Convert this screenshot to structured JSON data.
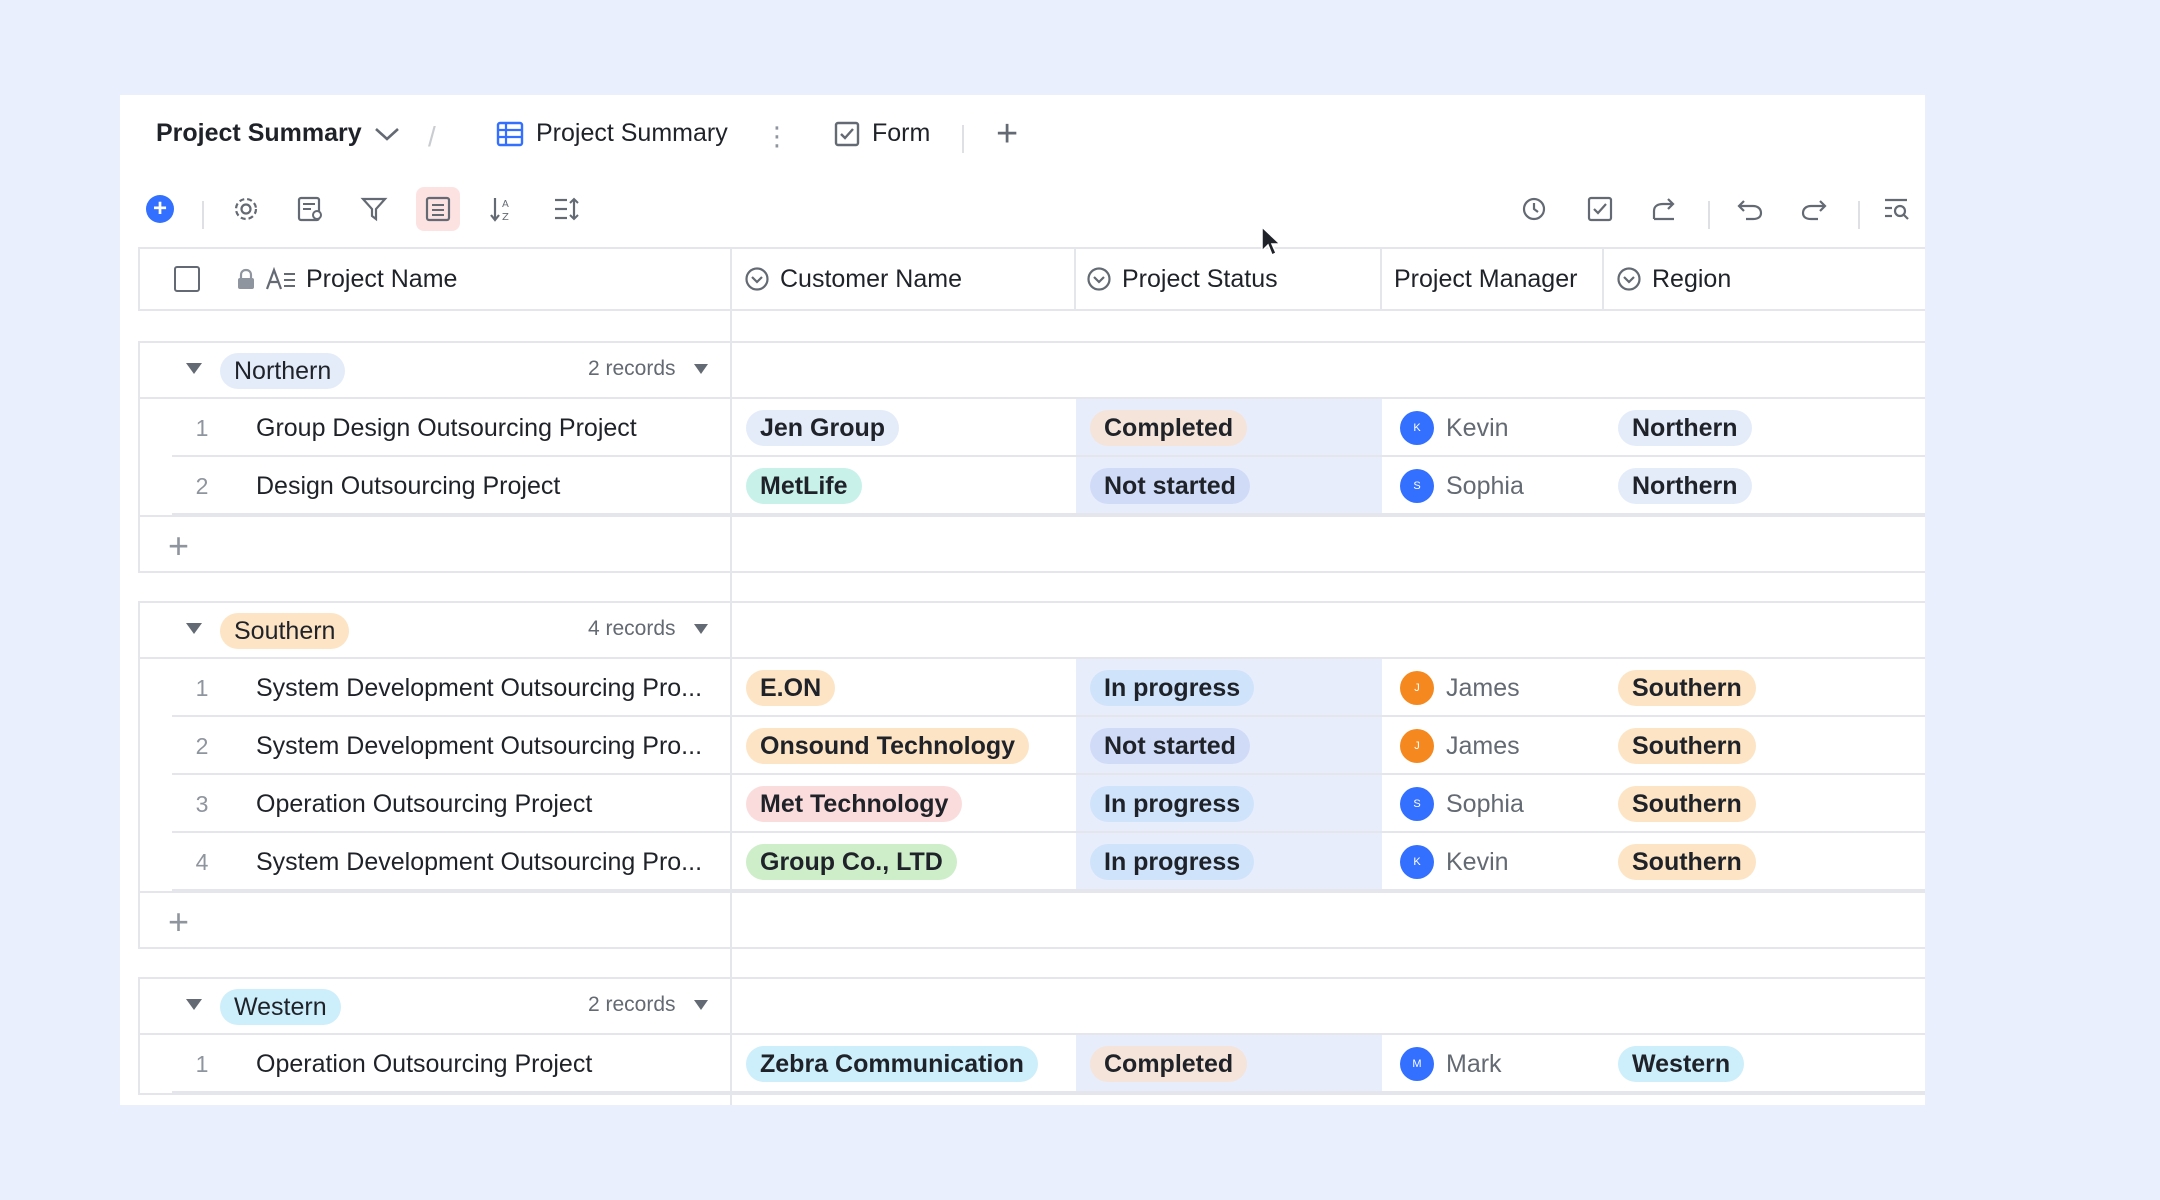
{
  "header": {
    "base_title": "Project Summary",
    "tabs": [
      {
        "label": "Project Summary",
        "icon": "grid-table-icon"
      },
      {
        "label": "Form",
        "icon": "form-check-icon"
      }
    ]
  },
  "columns": {
    "name": "Project Name",
    "customer": "Customer Name",
    "status": "Project Status",
    "manager": "Project Manager",
    "region": "Region"
  },
  "groups": [
    {
      "label": "Northern",
      "count": "2 records",
      "color": "#e4ecfa",
      "rows": [
        {
          "num": "1",
          "name": "Group Design Outsourcing Project",
          "customer": "Jen Group",
          "customer_color": "#e4ecfa",
          "status": "Completed",
          "status_color": "#f5e4d9",
          "manager": "Kevin",
          "initial": "K",
          "avatar_color": "#3370ff",
          "region": "Northern",
          "region_color": "#e4ecfa"
        },
        {
          "num": "2",
          "name": "Design Outsourcing Project",
          "customer": "MetLife",
          "customer_color": "#c8f1ea",
          "status": "Not started",
          "status_color": "#d0dcf7",
          "manager": "Sophia",
          "initial": "S",
          "avatar_color": "#3370ff",
          "region": "Northern",
          "region_color": "#e4ecfa"
        }
      ]
    },
    {
      "label": "Southern",
      "count": "4 records",
      "color": "#fde4c4",
      "rows": [
        {
          "num": "1",
          "name": "System Development Outsourcing Pro...",
          "customer": "E.ON",
          "customer_color": "#fde4c4",
          "status": "In progress",
          "status_color": "#cfe3fb",
          "manager": "James",
          "initial": "J",
          "avatar_color": "#f5891f",
          "region": "Southern",
          "region_color": "#fde4c4"
        },
        {
          "num": "2",
          "name": "System Development Outsourcing Pro...",
          "customer": "Onsound Technology",
          "customer_color": "#fde4c4",
          "status": "Not started",
          "status_color": "#d0dcf7",
          "manager": "James",
          "initial": "J",
          "avatar_color": "#f5891f",
          "region": "Southern",
          "region_color": "#fde4c4"
        },
        {
          "num": "3",
          "name": "Operation Outsourcing Project",
          "customer": "Met Technology",
          "customer_color": "#fbdcdc",
          "status": "In progress",
          "status_color": "#cfe3fb",
          "manager": "Sophia",
          "initial": "S",
          "avatar_color": "#3370ff",
          "region": "Southern",
          "region_color": "#fde4c4"
        },
        {
          "num": "4",
          "name": "System Development Outsourcing Pro...",
          "customer": "Group Co., LTD",
          "customer_color": "#cdeec8",
          "status": "In progress",
          "status_color": "#cfe3fb",
          "manager": "Kevin",
          "initial": "K",
          "avatar_color": "#3370ff",
          "region": "Southern",
          "region_color": "#fde4c4"
        }
      ]
    },
    {
      "label": "Western",
      "count": "2 records",
      "color": "#cdeefb",
      "rows": [
        {
          "num": "1",
          "name": "Operation Outsourcing Project",
          "customer": "Zebra Communication",
          "customer_color": "#cdeefb",
          "status": "Completed",
          "status_color": "#f5e4d9",
          "manager": "Mark",
          "initial": "M",
          "avatar_color": "#3370ff",
          "region": "Western",
          "region_color": "#cdeefb"
        }
      ]
    }
  ]
}
